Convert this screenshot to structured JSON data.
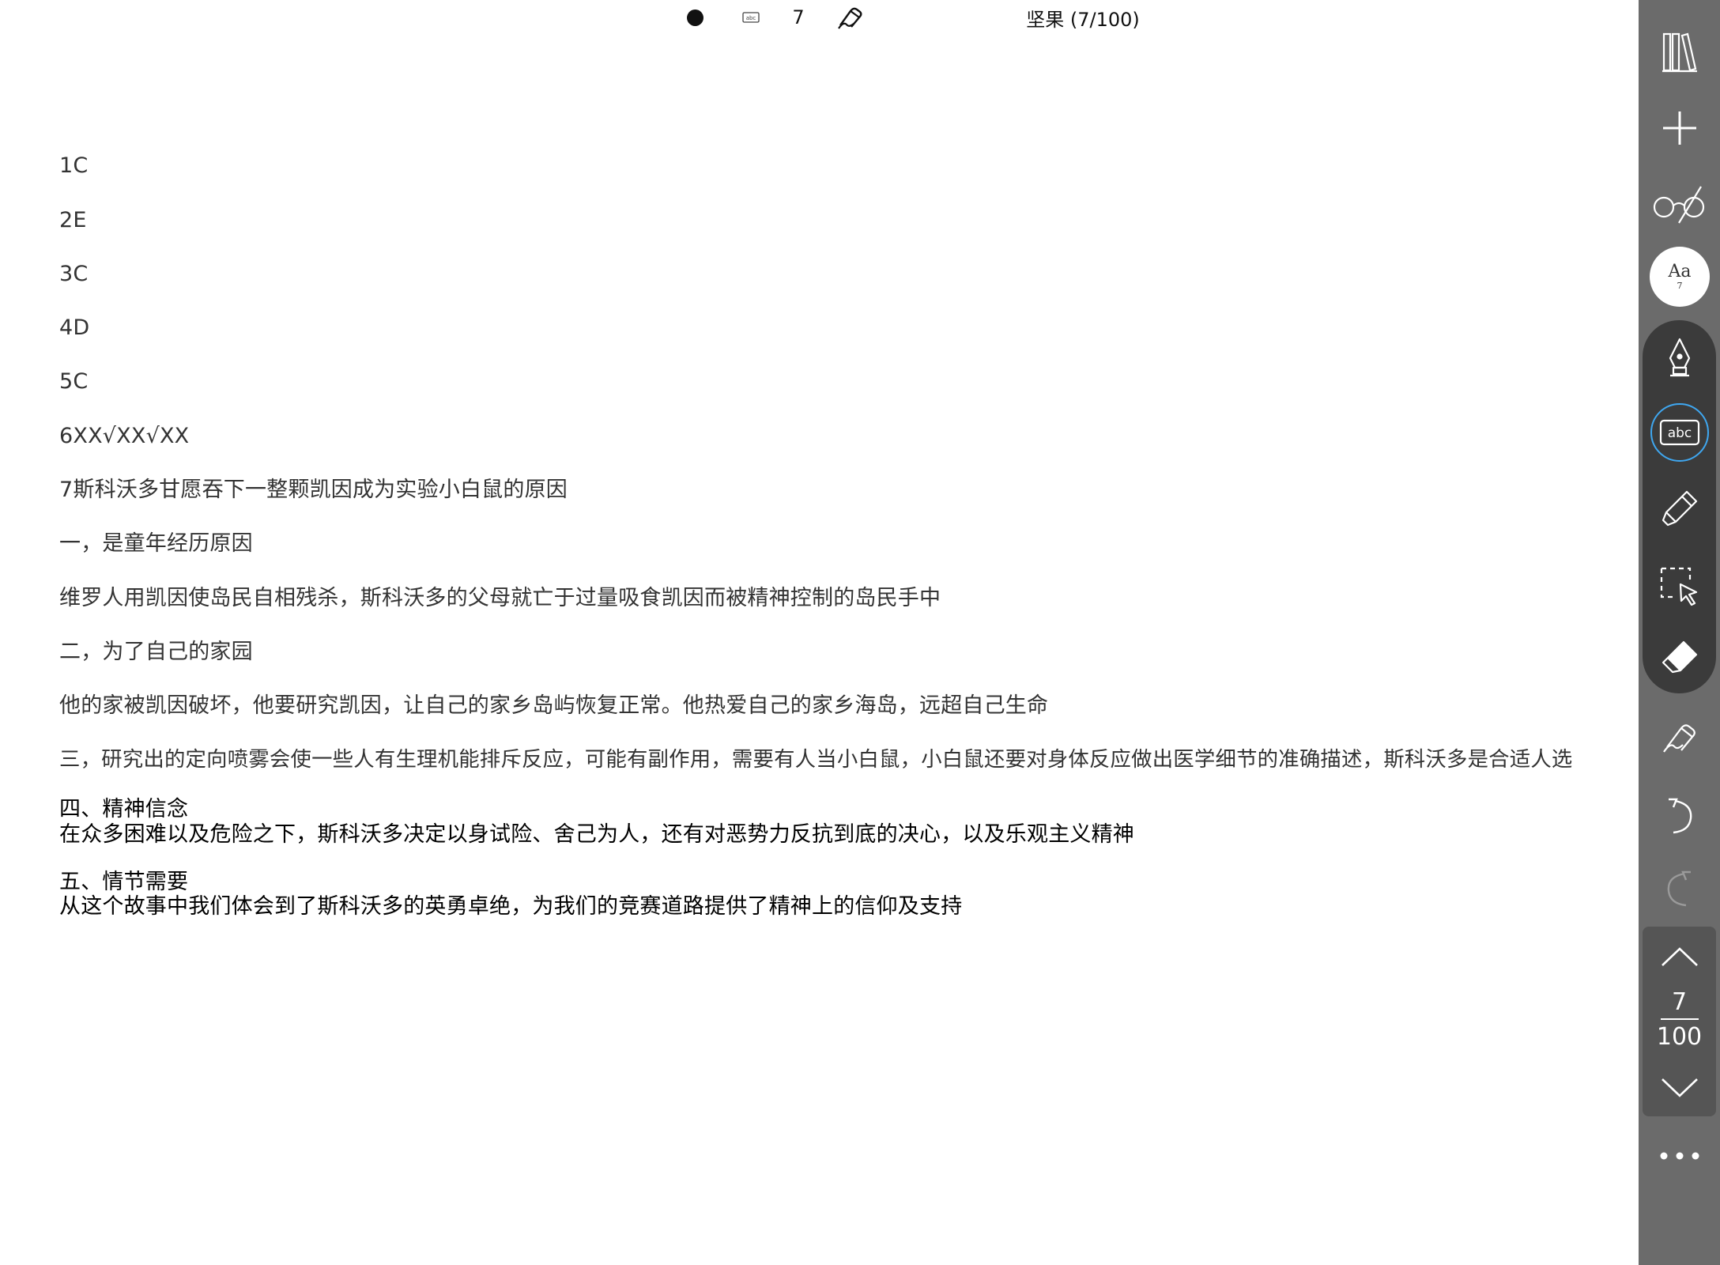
{
  "topbar": {
    "page_number": "7",
    "title": "坚果 (7/100)"
  },
  "content": {
    "lines": [
      "1C",
      "2E",
      "3C",
      "4D",
      "5C",
      "6XX√XX√XX",
      "7斯科沃多甘愿吞下一整颗凯因成为实验小白鼠的原因",
      "一，是童年经历原因",
      "维罗人用凯因使岛民自相残杀，斯科沃多的父母就亡于过量吸食凯因而被精神控制的岛民手中",
      "二，为了自己的家园",
      "他的家被凯因破坏，他要研究凯因，让自己的家乡岛屿恢复正常。他热爱自己的家乡海岛，远超自己生命",
      "三，研究出的定向喷雾会使一些人有生理机能排斥反应，可能有副作用，需要有人当小白鼠，小白鼠还要对身体反应做出医学细节的准确描述，斯科沃多是合适人选"
    ],
    "typed": [
      "四、精神信念",
      "在众多困难以及危险之下，斯科沃多决定以身试险、舍己为人，还有对恶势力反抗到底的决心，以及乐观主义精神",
      "五、情节需要",
      "从这个故事中我们体会到了斯科沃多的英勇卓绝，为我们的竞赛道路提供了精神上的信仰及支持"
    ]
  },
  "sidebar": {
    "font_button_label": "Aa",
    "font_button_size": "7",
    "abc_label": "abc",
    "current_page": "7",
    "total_pages": "100",
    "icons": [
      "library-icon",
      "plus-icon",
      "glasses-icon",
      "fountain-pen-icon",
      "text-recognition-icon",
      "highlighter-icon",
      "lasso-select-icon",
      "eraser-icon",
      "handwriting-icon",
      "undo-icon",
      "redo-icon",
      "chevron-up-icon",
      "chevron-down-icon",
      "more-icon"
    ],
    "accent_color": "#3fa7f0",
    "background_color": "#6b6b6b"
  }
}
